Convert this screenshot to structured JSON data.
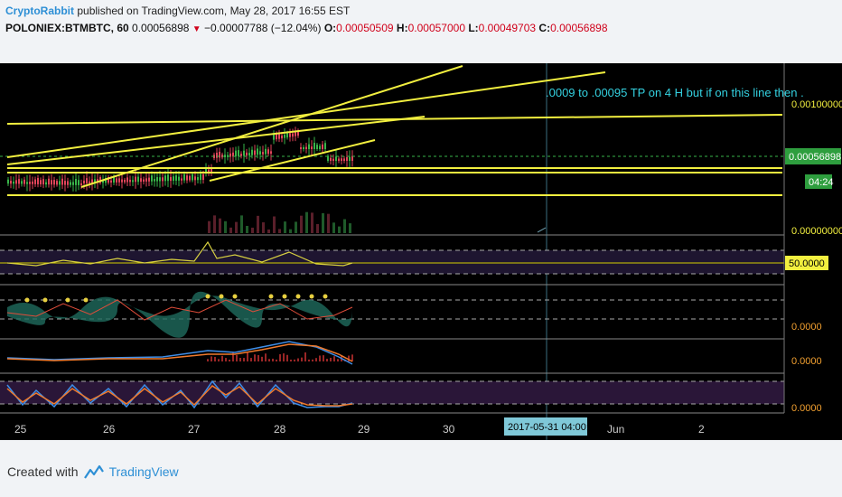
{
  "header": {
    "author": "CryptoRabbit",
    "published_text": "published on TradingView.com, May 28, 2017 16:55 EST",
    "symbol": "POLONIEX:BTMBTC, 60",
    "price": "0.00056898",
    "change": "−0.00007788 (−12.04%)",
    "o_label": "O:",
    "o_value": "0.00050509",
    "h_label": "H:",
    "h_value": "0.00057000",
    "l_label": "L:",
    "l_value": "0.00049703",
    "c_label": "C:",
    "c_value": "0.00056898"
  },
  "chart": {
    "annotation": ".0009 to .00095 TP on 4 H but if on this line then .",
    "price_axis": {
      "label_top": "0.00100000",
      "label_current": "0.00056898",
      "label_timer": "04:24",
      "label_zero": "0.00000000"
    },
    "rsi_label": "50.0000",
    "osc_labels": [
      "0.0000",
      "0.0000",
      "0.0000"
    ],
    "date_labels": [
      "25",
      "26",
      "27",
      "28",
      "29",
      "30",
      "Jun",
      "2"
    ],
    "cursor_date": "2017-05-31 04:00:00",
    "colors": {
      "background": "#000000",
      "trendline": "#f2ef3f",
      "up": "#39b54a",
      "down": "#e0455a",
      "current": "#2e9e3e"
    }
  },
  "footer": {
    "created_with": "Created with",
    "brand": "TradingView",
    "logo_icon": "tradingview-logo-icon"
  }
}
